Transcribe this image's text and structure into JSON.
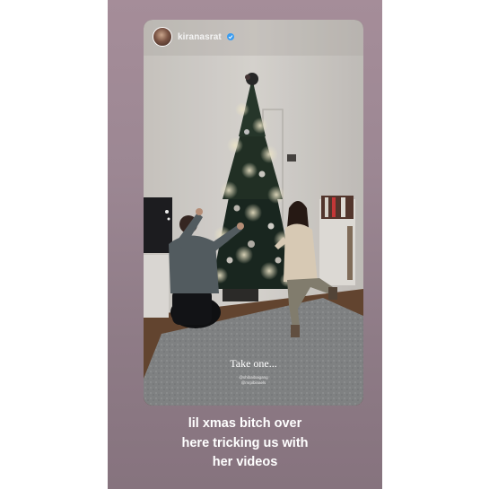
{
  "story": {
    "username": "kiranasrat",
    "verified": true,
    "video_caption": "Take one...",
    "video_credits": [
      "@shibaibaigang",
      "@mrpibinaels"
    ],
    "text_lines": [
      "lil xmas bitch over",
      "here tricking us with",
      "her videos"
    ]
  },
  "colors": {
    "frame_background": "#9c8793",
    "verified_badge": "#3a9cf0",
    "text": "#ffffff"
  },
  "icons": {
    "verified": "verified-badge-icon",
    "avatar": "profile-avatar"
  }
}
